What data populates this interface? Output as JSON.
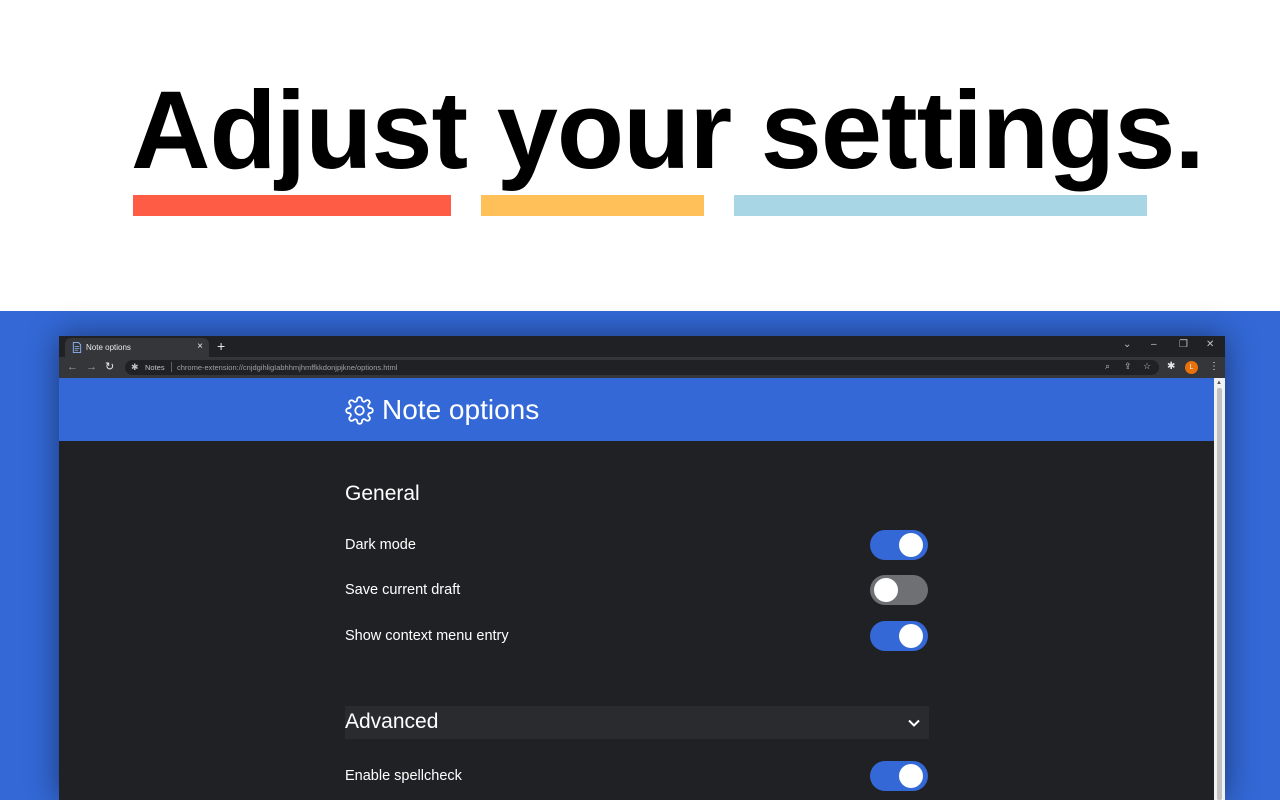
{
  "hero": {
    "headline": "Adjust your settings.",
    "bar_colors": [
      "#ff5c45",
      "#ffc05a",
      "#a9d6e5"
    ]
  },
  "colors": {
    "stage_background": "#3368d6",
    "accent": "#3368d6",
    "toggle_off": "#6f7073"
  },
  "browser": {
    "tab_title": "Note options",
    "new_tab_icon": "+",
    "extension_chip": "Notes",
    "url": "chrome-extension://cnjdgihligIabhhmjhmffkkdonjpjkne/options.html",
    "avatar_letter": "L"
  },
  "page": {
    "title": "Note options",
    "header_icon": "gear-icon",
    "sections": {
      "general": {
        "title": "General",
        "settings": [
          {
            "label": "Dark mode",
            "enabled": true
          },
          {
            "label": "Save current draft",
            "enabled": false
          },
          {
            "label": "Show context menu entry",
            "enabled": true
          }
        ]
      },
      "advanced": {
        "title": "Advanced",
        "expanded": true,
        "settings": [
          {
            "label": "Enable spellcheck",
            "enabled": true
          }
        ]
      }
    }
  }
}
